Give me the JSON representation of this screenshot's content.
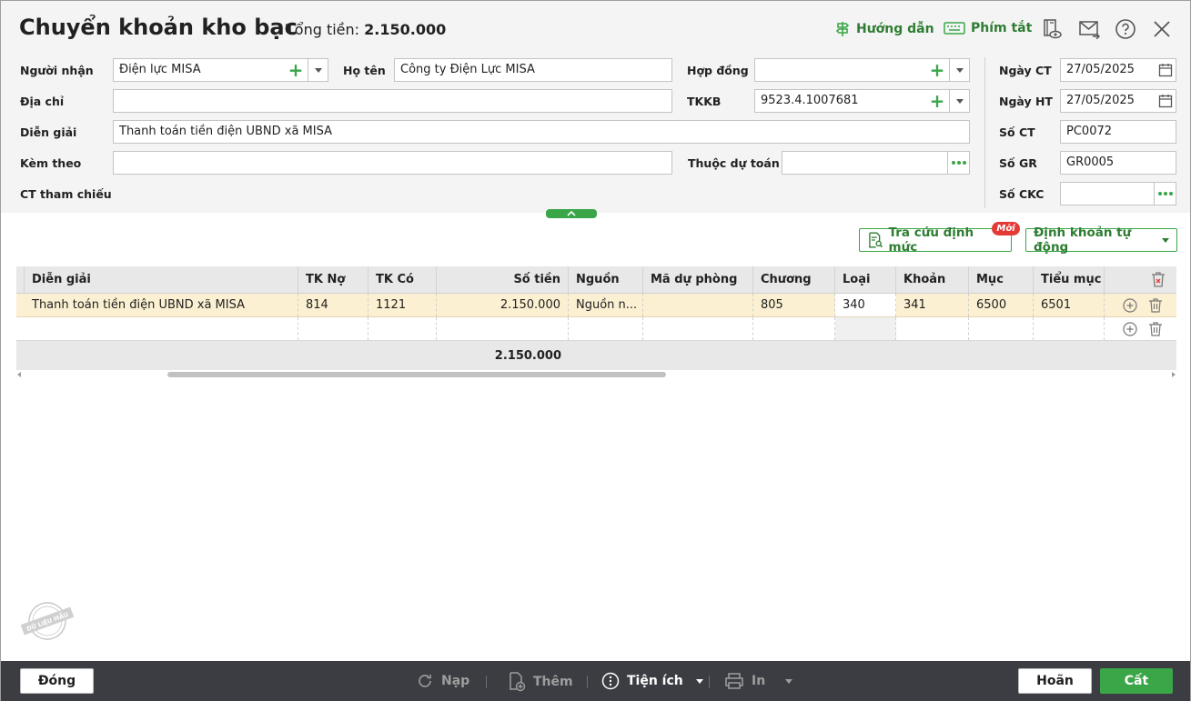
{
  "header": {
    "title": "Chuyển khoản kho bạc",
    "total_label": "Tổng tiền:",
    "total_value": "2.150.000",
    "guide_label": "Hướng dẫn",
    "shortcut_label": "Phím tắt"
  },
  "form": {
    "nguoi_nhan": {
      "label": "Người nhận",
      "value": "Điện lực MISA"
    },
    "ho_ten": {
      "label": "Họ tên",
      "value": "Công ty Điện Lực MISA"
    },
    "hop_dong": {
      "label": "Hợp đồng",
      "value": ""
    },
    "dia_chi": {
      "label": "Địa chỉ",
      "value": ""
    },
    "tkkb": {
      "label": "TKKB",
      "value": "9523.4.1007681"
    },
    "dien_giai": {
      "label": "Diễn giải",
      "value": "Thanh toán tiền điện UBND xã MISA"
    },
    "kem_theo": {
      "label": "Kèm theo",
      "value": ""
    },
    "thuoc_du_toan": {
      "label": "Thuộc dự toán",
      "value": ""
    },
    "ct_tham_chieu": {
      "label": "CT tham chiếu"
    },
    "ngay_ct": {
      "label": "Ngày CT",
      "value": "27/05/2025"
    },
    "ngay_ht": {
      "label": "Ngày HT",
      "value": "27/05/2025"
    },
    "so_ct": {
      "label": "Số CT",
      "value": "PC0072"
    },
    "so_gr": {
      "label": "Số GR",
      "value": "GR0005"
    },
    "so_ckc": {
      "label": "Số CKC",
      "value": ""
    }
  },
  "actions": {
    "tra_cuu": "Tra cứu định mức",
    "new_badge": "Mới",
    "dinh_khoan": "Định khoản tự động"
  },
  "table": {
    "columns": [
      "Diễn giải",
      "TK Nợ",
      "TK Có",
      "Số tiền",
      "Nguồn",
      "Mã dự phòng",
      "Chương",
      "Loại",
      "Khoản",
      "Mục",
      "Tiểu mục"
    ],
    "rows": [
      [
        "Thanh toán tiền điện UBND xã MISA",
        "814",
        "1121",
        "2.150.000",
        "Nguồn n...",
        "",
        "805",
        "340",
        "341",
        "6500",
        "6501"
      ]
    ],
    "footer_total": "2.150.000"
  },
  "watermark": "DỮ LIỆU MẪU",
  "footer": {
    "close": "Đóng",
    "reload": "Nạp",
    "add": "Thêm",
    "utility": "Tiện ích",
    "print": "In",
    "cancel": "Hoãn",
    "save": "Cất"
  },
  "colors": {
    "accent": "#3aa648",
    "bottom_bar": "#3b3d42",
    "selected_row": "#fcf0d2",
    "badge": "#e53935"
  }
}
